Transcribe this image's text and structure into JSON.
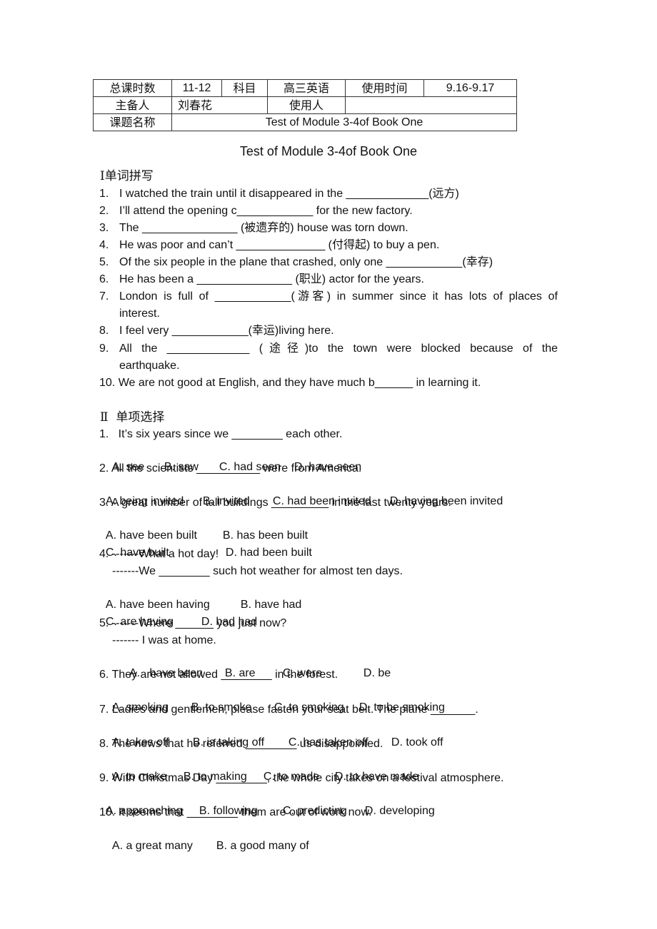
{
  "info_table": {
    "total_hours_label": "总课时数",
    "total_hours_value": "11-12",
    "subject_label": "科目",
    "subject_value": "高三英语",
    "use_time_label": "使用时间",
    "use_time_value": "9.16-9.17",
    "preparer_label": "主备人",
    "preparer_value": "刘春花",
    "user_label": "使用人",
    "user_value": "",
    "topic_label": "课题名称",
    "topic_value": "Test of Module 3-4of Book One"
  },
  "title": "Test of Module 3-4of Book One",
  "section1": {
    "heading": "Ⅰ单词拼写",
    "items": [
      {
        "num": "1.",
        "text": "I watched the train until it disappeared in the _____________(远方)"
      },
      {
        "num": "2.",
        "text": "I’ll attend the opening c____________ for the new factory."
      },
      {
        "num": "3.",
        "text": "The _______________ (被遗弃的) house was torn down."
      },
      {
        "num": "4.",
        "text": "He was poor and can’t ______________ (付得起) to buy a pen."
      },
      {
        "num": "5.",
        "text": "Of the six people in the plane that crashed, only one ____________(幸存)"
      },
      {
        "num": "6.",
        "text": "He has been a _______________ (职业) actor for the years."
      },
      {
        "num": "7.",
        "text": "London is full of ____________(游客) in summer since it has lots of places of",
        "cont": "interest."
      },
      {
        "num": "8.",
        "text": "I feel very ____________(幸运)living here."
      },
      {
        "num": "9.",
        "text": "All the _____________ (途径)to the town were blocked because of the",
        "cont": "earthquake."
      },
      {
        "num": "10.",
        "text": "We are not good at English, and they have much b______ in learning it."
      }
    ]
  },
  "section2": {
    "heading": "Ⅱ  单项选择",
    "questions": [
      {
        "q": "1.   It’s six years since we ________ each other.",
        "options": [
          "A. see",
          "B. saw",
          "C. had seen",
          "D. have seen"
        ]
      },
      {
        "q": "2. All the scientists __________ were from America.",
        "options": [
          "A. being invited",
          "B. invited",
          "C. had been invited",
          "D. having been invited"
        ]
      },
      {
        "q": "3. A great number of tall buildings _________ in the last twenty years.",
        "options": [
          "A. have been built",
          "B. has been built",
          "C. have built",
          "D. had been built"
        ]
      },
      {
        "q": "4. -------What a hot day!",
        "q2": "-------We ________ such hot weather for almost ten days.",
        "options": [
          "A. have been having",
          "B. have had",
          "C. are having",
          "D. had had"
        ]
      },
      {
        "q": "5. -------Where ______ you just now?",
        "q2": "------- I was at home.",
        "options": [
          "A.   have been",
          "B. are",
          "C. were",
          "D. be"
        ]
      },
      {
        "q": "6. They are not allowed ________ in the forest.",
        "options": [
          "A. smoking",
          "B. to smoke",
          "C. to smoking",
          "D. to be smoking"
        ]
      },
      {
        "q": "7. Ladies and gentlemen, please fasten your seat belt. The plane _______.",
        "options": [
          "A. takes off",
          "B. is taking off",
          "C. has taken off",
          "D. took off"
        ]
      },
      {
        "q": "8. The news that he referred ________ us disappointed.",
        "options": [
          "A. to make",
          "B. to making",
          "C. to made",
          "D. to have made"
        ]
      },
      {
        "q": "9. With Christmas Day ________, the whole city takes on a festival atmosphere.",
        "options": [
          "A. approaching",
          "B. following",
          "C. predicting",
          "D. developing"
        ]
      },
      {
        "q": "10. It seems that ________ them are out of work now.",
        "options": [
          "A. a great many",
          "B. a good many of"
        ]
      }
    ]
  }
}
